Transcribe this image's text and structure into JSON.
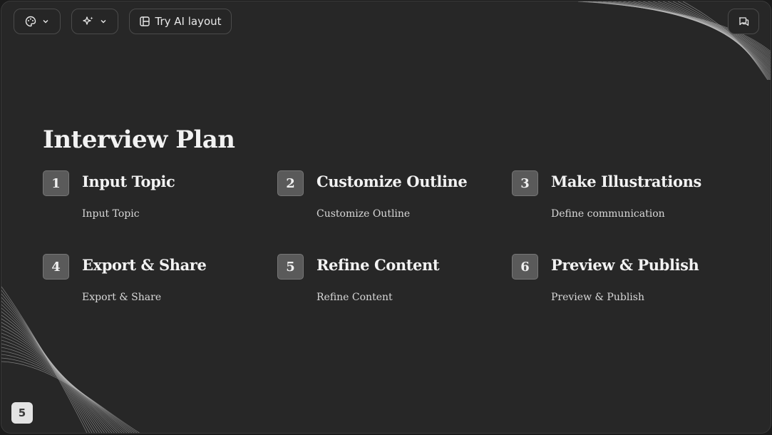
{
  "toolbar": {
    "theme_icon": "palette-icon",
    "ai_icon": "sparkles-icon",
    "layout_icon": "layout-icon",
    "layout_label": "Try AI layout",
    "comment_icon": "comment-icon",
    "dropdown_icon": "chevron-down-icon"
  },
  "slide": {
    "title": "Interview Plan",
    "steps": [
      {
        "number": "1",
        "heading": "Input Topic",
        "description": "Input Topic"
      },
      {
        "number": "2",
        "heading": "Customize Outline",
        "description": "Customize Outline"
      },
      {
        "number": "3",
        "heading": "Make Illustrations",
        "description": "Define communication"
      },
      {
        "number": "4",
        "heading": "Export & Share",
        "description": "Export & Share"
      },
      {
        "number": "5",
        "heading": "Refine Content",
        "description": "Refine Content"
      },
      {
        "number": "6",
        "heading": "Preview & Publish",
        "description": "Preview & Publish"
      }
    ],
    "page_number": "5"
  },
  "colors": {
    "background": "#272727",
    "text": "#f2f2f2",
    "number_box": "#5a5a5a"
  }
}
